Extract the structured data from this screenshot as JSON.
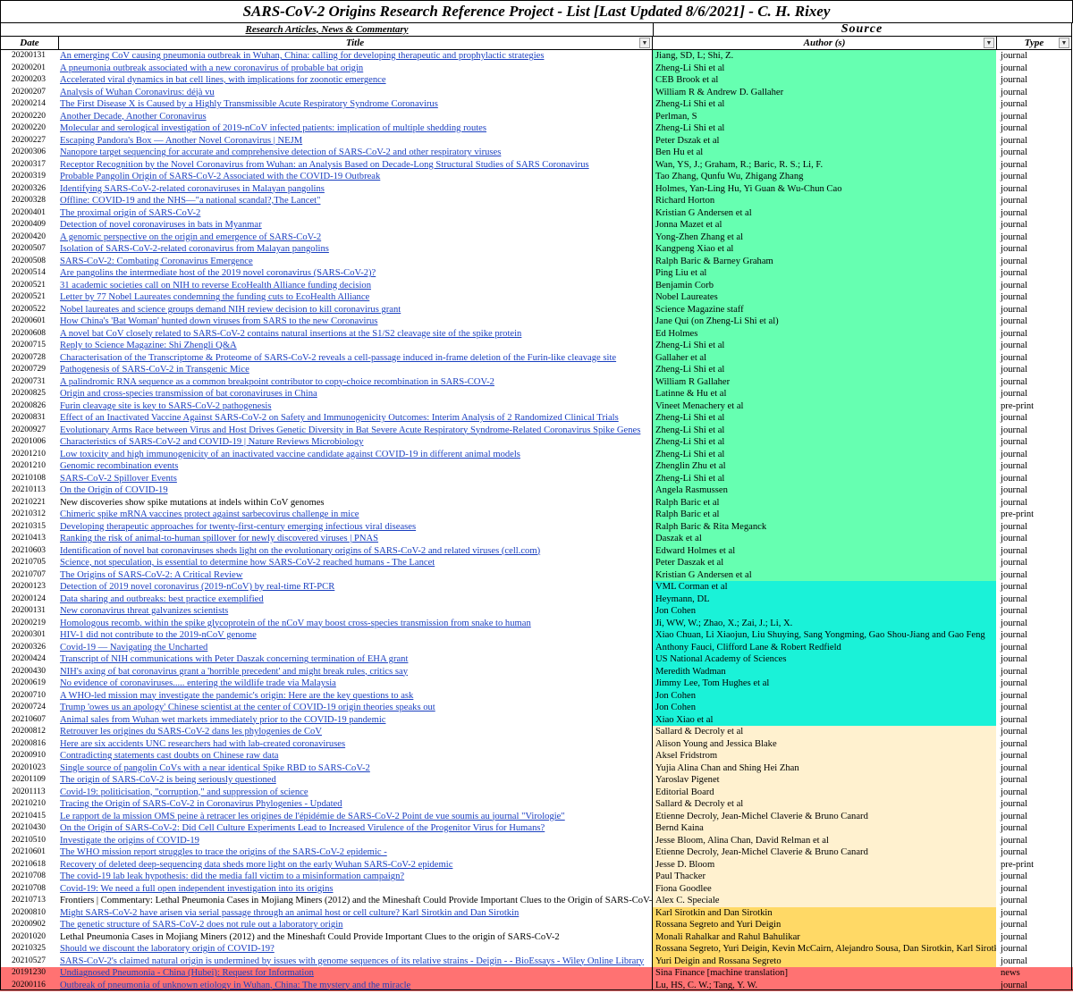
{
  "sheet": {
    "title": "SARS-CoV-2 Origins Research Reference Project - List [Last Updated 8/6/2021] - C. H. Rixey",
    "section_left": "Research Articles, News & Commentary",
    "section_right": "Source",
    "headers": {
      "date": "Date",
      "title": "Title",
      "author": "Author (s)",
      "type": "Type"
    },
    "filter_glyph": "▼",
    "band_colors": {
      "green": "#66ffb1",
      "teal": "#1af2d8",
      "peach": "#fff1cf",
      "yellow": "#ffd966",
      "red": "#ff7272"
    },
    "link_color": "#1a3fc0"
  },
  "rows": [
    {
      "date": "20200131",
      "title": "An emerging CoV causing pneumonia outbreak in Wuhan, China: calling for developing therapeutic and prophylactic strategies",
      "author": "Jiang, SD, L; Shi, Z.",
      "type": "journal",
      "band": "green",
      "link": true
    },
    {
      "date": "20200201",
      "title": "A pneumonia outbreak associated with a new coronavirus of probable bat origin",
      "author": "Zheng-Li Shi et al",
      "type": "journal",
      "band": "green",
      "link": true
    },
    {
      "date": "20200203",
      "title": "Accelerated viral dynamics in bat cell lines, with implications for zoonotic emergence",
      "author": "CEB Brook et al",
      "type": "journal",
      "band": "green",
      "link": true
    },
    {
      "date": "20200207",
      "title": "Analysis of Wuhan Coronavirus: déjà vu",
      "author": "William R & Andrew D. Gallaher",
      "type": "journal",
      "band": "green",
      "link": true
    },
    {
      "date": "20200214",
      "title": "The First Disease X is Caused by a Highly Transmissible Acute Respiratory Syndrome Coronavirus",
      "author": "Zheng-Li Shi et al",
      "type": "journal",
      "band": "green",
      "link": true
    },
    {
      "date": "20200220",
      "title": "Another Decade, Another Coronavirus",
      "author": "Perlman, S",
      "type": "journal",
      "band": "green",
      "link": true
    },
    {
      "date": "20200220",
      "title": "Molecular and serological investigation of 2019-nCoV infected patients: implication of multiple shedding routes",
      "author": "Zheng-Li Shi et al",
      "type": "journal",
      "band": "green",
      "link": true
    },
    {
      "date": "20200227",
      "title": "Escaping Pandora's Box — Another Novel Coronavirus | NEJM",
      "author": "Peter Dszak et al",
      "type": "journal",
      "band": "green",
      "link": true
    },
    {
      "date": "20200306",
      "title": "Nanopore target sequencing for accurate and comprehensive detection of SARS-CoV-2 and other respiratory viruses",
      "author": "Ben Hu et al",
      "type": "journal",
      "band": "green",
      "link": true
    },
    {
      "date": "20200317",
      "title": "Receptor Recognition by the Novel Coronavirus from Wuhan: an Analysis Based on Decade-Long Structural Studies of SARS Coronavirus",
      "author": "Wan, YS, J.; Graham, R.; Baric, R. S.; Li, F.",
      "type": "journal",
      "band": "green",
      "link": true
    },
    {
      "date": "20200319",
      "title": "Probable Pangolin Origin of SARS-CoV-2 Associated with the COVID-19 Outbreak",
      "author": "Tao Zhang, Qunfu Wu, Zhigang Zhang",
      "type": "journal",
      "band": "green",
      "link": true
    },
    {
      "date": "20200326",
      "title": "Identifying SARS-CoV-2-related coronaviruses in Malayan pangolins",
      "author": "Holmes, Yan-Ling Hu, Yi Guan & Wu-Chun Cao",
      "type": "journal",
      "band": "green",
      "link": true
    },
    {
      "date": "20200328",
      "title": "Offline: COVID-19 and the NHS—\"a national scandal?,The Lancet\"",
      "author": "Richard Horton",
      "type": "journal",
      "band": "green",
      "link": true
    },
    {
      "date": "20200401",
      "title": "The proximal origin of SARS-CoV-2",
      "author": "Kristian G Andersen et al",
      "type": "journal",
      "band": "green",
      "link": true
    },
    {
      "date": "20200409",
      "title": "Detection of novel coronaviruses in bats in Myanmar",
      "author": "Jonna Mazet et al",
      "type": "journal",
      "band": "green",
      "link": true
    },
    {
      "date": "20200420",
      "title": "A genomic perspective on the origin and emergence of SARS-CoV-2",
      "author": "Yong-Zhen Zhang et al",
      "type": "journal",
      "band": "green",
      "link": true
    },
    {
      "date": "20200507",
      "title": "Isolation of SARS-CoV-2-related coronavirus from Malayan pangolins",
      "author": "Kangpeng Xiao et al",
      "type": "journal",
      "band": "green",
      "link": true
    },
    {
      "date": "20200508",
      "title": "SARS-CoV-2: Combating Coronavirus Emergence",
      "author": "Ralph Baric & Barney Graham",
      "type": "journal",
      "band": "green",
      "link": true
    },
    {
      "date": "20200514",
      "title": "Are pangolins the intermediate host of the 2019 novel coronavirus (SARS-CoV-2)?",
      "author": "Ping Liu et al",
      "type": "journal",
      "band": "green",
      "link": true
    },
    {
      "date": "20200521",
      "title": "31 academic societies call on NIH to reverse EcoHealth Alliance funding decision",
      "author": "Benjamin Corb",
      "type": "journal",
      "band": "green",
      "link": true
    },
    {
      "date": "20200521",
      "title": "Letter by 77 Nobel Laureates condemning the funding cuts to EcoHealth Alliance",
      "author": "Nobel Laureates",
      "type": "journal",
      "band": "green",
      "link": true
    },
    {
      "date": "20200522",
      "title": "Nobel laureates and science groups demand NIH review decision to kill coronavirus grant",
      "author": "Science Magazine staff",
      "type": "journal",
      "band": "green",
      "link": true
    },
    {
      "date": "20200601",
      "title": "How China's 'Bat Woman' hunted down viruses from SARS to the new Coronavirus",
      "author": "Jane Qui (on Zheng-Li Shi et al)",
      "type": "journal",
      "band": "green",
      "link": true
    },
    {
      "date": "20200608",
      "title": "A novel bat CoV closely related to SARS-CoV-2 contains natural insertions at the S1/S2 cleavage site of the spike protein",
      "author": "Ed Holmes",
      "type": "journal",
      "band": "green",
      "link": true
    },
    {
      "date": "20200715",
      "title": "Reply to Science Magazine: Shi Zhengli Q&A",
      "author": "Zheng-Li Shi et al",
      "type": "journal",
      "band": "green",
      "link": true
    },
    {
      "date": "20200728",
      "title": "Characterisation of the Transcriptome & Proteome of SARS-CoV-2 reveals a cell-passage induced in-frame deletion of the Furin-like cleavage site",
      "author": "Gallaher et al",
      "type": "journal",
      "band": "green",
      "link": true
    },
    {
      "date": "20200729",
      "title": "Pathogenesis of SARS-CoV-2 in Transgenic Mice",
      "author": "Zheng-Li Shi et al",
      "type": "journal",
      "band": "green",
      "link": true
    },
    {
      "date": "20200731",
      "title": "A palindromic RNA sequence as a common breakpoint contributor to copy-choice recombination in SARS-COV-2",
      "author": "William R Gallaher",
      "type": "journal",
      "band": "green",
      "link": true
    },
    {
      "date": "20200825",
      "title": "Origin and cross-species transmission of bat coronaviruses in China",
      "author": "Latinne & Hu et al",
      "type": "journal",
      "band": "green",
      "link": true
    },
    {
      "date": "20200826",
      "title": "Furin cleavage site is key to SARS-CoV-2 pathogenesis",
      "author": "Vineet Menachery et al",
      "type": "pre-print",
      "band": "green",
      "link": true
    },
    {
      "date": "20200831",
      "title": "Effect of an Inactivated Vaccine Against SARS-CoV-2 on Safety and Immunogenicity Outcomes: Interim Analysis of 2 Randomized Clinical Trials",
      "author": "Zheng-Li Shi et al",
      "type": "journal",
      "band": "green",
      "link": true
    },
    {
      "date": "20200927",
      "title": "Evolutionary Arms Race between Virus and Host Drives Genetic Diversity in Bat Severe Acute Respiratory Syndrome-Related Coronavirus Spike Genes",
      "author": "Zheng-Li Shi et al",
      "type": "journal",
      "band": "green",
      "link": true
    },
    {
      "date": "20201006",
      "title": "Characteristics of SARS-CoV-2 and COVID-19 | Nature Reviews Microbiology",
      "author": "Zheng-Li Shi et al",
      "type": "journal",
      "band": "green",
      "link": true
    },
    {
      "date": "20201210",
      "title": "Low toxicity and high immunogenicity of an inactivated vaccine candidate against COVID-19 in different animal models",
      "author": "Zheng-Li Shi et al",
      "type": "journal",
      "band": "green",
      "link": true
    },
    {
      "date": "20201210",
      "title": "Genomic recombination events",
      "author": "Zhenglin Zhu et al",
      "type": "journal",
      "band": "green",
      "link": true
    },
    {
      "date": "20210108",
      "title": "SARS-CoV-2 Spillover Events",
      "author": "Zheng-Li Shi et al",
      "type": "journal",
      "band": "green",
      "link": true
    },
    {
      "date": "20210113",
      "title": "On the Origin of COVID-19",
      "author": "Angela Rasmussen",
      "type": "journal",
      "band": "green",
      "link": true
    },
    {
      "date": "20210221",
      "title": "New discoveries show spike mutations at indels within CoV genomes",
      "author": "Ralph Baric et al",
      "type": "journal",
      "band": "green",
      "link": false
    },
    {
      "date": "20210312",
      "title": "Chimeric spike mRNA vaccines protect against sarbecovirus challenge in mice",
      "author": "Ralph Baric et al",
      "type": "pre-print",
      "band": "green",
      "link": true
    },
    {
      "date": "20210315",
      "title": "Developing therapeutic approaches for twenty-first-century emerging infectious viral diseases",
      "author": "Ralph Baric & Rita Meganck",
      "type": "journal",
      "band": "green",
      "link": true
    },
    {
      "date": "20210413",
      "title": "Ranking the risk of animal-to-human spillover for newly discovered viruses | PNAS",
      "author": "Daszak et al",
      "type": "journal",
      "band": "green",
      "link": true
    },
    {
      "date": "20210603",
      "title": "Identification of novel bat coronaviruses sheds light on the evolutionary origins of SARS-CoV-2 and related viruses (cell.com)",
      "author": "Edward Holmes et al",
      "type": "journal",
      "band": "green",
      "link": true
    },
    {
      "date": "20210705",
      "title": "Science, not speculation, is essential to determine how SARS-CoV-2 reached humans - The Lancet",
      "author": "Peter Daszak et al",
      "type": "journal",
      "band": "green",
      "link": true
    },
    {
      "date": "20210707",
      "title": "The Origins of SARS-CoV-2: A Critical Review",
      "author": "Kristian G Andersen et al",
      "type": "journal",
      "band": "green",
      "link": true
    },
    {
      "date": "20200123",
      "title": "Detection of 2019 novel coronavirus (2019-nCoV) by real-time RT-PCR",
      "author": "VML Corman et al",
      "type": "journal",
      "band": "teal",
      "link": true
    },
    {
      "date": "20200124",
      "title": "Data sharing and outbreaks: best practice exemplified",
      "author": "Heymann, DL",
      "type": "journal",
      "band": "teal",
      "link": true
    },
    {
      "date": "20200131",
      "title": "New coronavirus threat galvanizes scientists",
      "author": "Jon Cohen",
      "type": "journal",
      "band": "teal",
      "link": true
    },
    {
      "date": "20200219",
      "title": "Homologous recomb. within the spike glycoprotein of the nCoV may boost cross-species transmission from snake to human",
      "author": "Ji, WW, W.; Zhao, X.; Zai, J.; Li, X.",
      "type": "journal",
      "band": "teal",
      "link": true
    },
    {
      "date": "20200301",
      "title": "HIV-1 did not contribute to the 2019-nCoV genome",
      "author": "Xiao Chuan, Li Xiaojun, Liu Shuying, Sang Yongming, Gao Shou-Jiang and Gao Feng",
      "type": "journal",
      "band": "teal",
      "link": true
    },
    {
      "date": "20200326",
      "title": "Covid-19 — Navigating the Uncharted",
      "author": "Anthony Fauci, Clifford Lane & Robert Redfield",
      "type": "journal",
      "band": "teal",
      "link": true
    },
    {
      "date": "20200424",
      "title": "Transcript of NIH communications with Peter Daszak concerning termination of EHA grant",
      "author": "US National Academy of Sciences",
      "type": "journal",
      "band": "teal",
      "link": true
    },
    {
      "date": "20200430",
      "title": "NIH's axing of bat coronavirus grant a 'horrible precedent' and might break rules, critics say",
      "author": "Meredith Wadman",
      "type": "journal",
      "band": "teal",
      "link": true
    },
    {
      "date": "20200619",
      "title": "No evidence of coronaviruses..... entering the wildlife trade via Malaysia",
      "author": "Jimmy Lee, Tom Hughes et al",
      "type": "journal",
      "band": "teal",
      "link": true
    },
    {
      "date": "20200710",
      "title": "A WHO-led mission may investigate the pandemic's origin:  Here are the key questions to ask",
      "author": "Jon Cohen",
      "type": "journal",
      "band": "teal",
      "link": true
    },
    {
      "date": "20200724",
      "title": "Trump 'owes us an apology' Chinese scientist at the center of COVID-19 origin theories speaks out",
      "author": "Jon Cohen",
      "type": "journal",
      "band": "teal",
      "link": true
    },
    {
      "date": "20210607",
      "title": "Animal sales from Wuhan wet markets immediately prior to the COVID-19 pandemic",
      "author": "Xiao Xiao et al",
      "type": "journal",
      "band": "teal",
      "link": true
    },
    {
      "date": "20200812",
      "title": "Retrouver les origines du SARS-CoV-2 dans les phylogenies de CoV",
      "author": "Sallard & Decroly et al",
      "type": "journal",
      "band": "peach",
      "link": true
    },
    {
      "date": "20200816",
      "title": "Here are six accidents UNC researchers had with lab-created coronaviruses",
      "author": "Alison Young and Jessica Blake",
      "type": "journal",
      "band": "peach",
      "link": true
    },
    {
      "date": "20200910",
      "title": "Contradicting statements cast doubts on Chinese raw data",
      "author": "Aksel Fridstrom",
      "type": "journal",
      "band": "peach",
      "link": true
    },
    {
      "date": "20201023",
      "title": "Single source of pangolin CoVs with a near identical Spike RBD to SARS-CoV-2",
      "author": "Yujia Alina Chan and Shing Hei Zhan",
      "type": "journal",
      "band": "peach",
      "link": true
    },
    {
      "date": "20201109",
      "title": "The origin of SARS-CoV-2 is being seriously questioned",
      "author": "Yaroslav Pigenet",
      "type": "journal",
      "band": "peach",
      "link": true
    },
    {
      "date": "20201113",
      "title": "Covid-19: politicisation, \"corruption,\" and suppression of science",
      "author": "Editorial Board",
      "type": "journal",
      "band": "peach",
      "link": true
    },
    {
      "date": "20210210",
      "title": "Tracing the Origin of SARS-CoV-2 in Coronavirus Phylogenies - Updated",
      "author": "Sallard & Decroly et al",
      "type": "journal",
      "band": "peach",
      "link": true
    },
    {
      "date": "20210415",
      "title": "Le rapport de la mission OMS peine à retracer les origines de l'épidémie de SARS-CoV-2 Point de vue soumis au journal \"Virologie\"",
      "author": "Etienne Decroly, Jean-Michel Claverie & Bruno Canard",
      "type": "journal",
      "band": "peach",
      "link": true
    },
    {
      "date": "20210430",
      "title": "On the Origin of SARS-CoV-2: Did Cell Culture Experiments Lead to Increased Virulence of the Progenitor Virus for Humans?",
      "author": "Bernd Kaina",
      "type": "journal",
      "band": "peach",
      "link": true
    },
    {
      "date": "20210510",
      "title": "Investigate the origins of COVID-19",
      "author": "Jesse Bloom, Alina Chan, David Relman et al",
      "type": "journal",
      "band": "peach",
      "link": true
    },
    {
      "date": "20210601",
      "title": "The WHO mission report struggles to trace the origins of the SARS-CoV-2 epidemic -",
      "author": "Etienne Decroly, Jean-Michel Claverie & Bruno Canard",
      "type": "journal",
      "band": "peach",
      "link": true
    },
    {
      "date": "20210618",
      "title": "Recovery of deleted deep-sequencing data sheds more light on the early Wuhan SARS-CoV-2 epidemic",
      "author": "Jesse D. Bloom",
      "type": "pre-print",
      "band": "peach",
      "link": true
    },
    {
      "date": "20210708",
      "title": "The covid-19 lab leak hypothesis: did the media fall victim to a misinformation campaign?",
      "author": "Paul Thacker",
      "type": "journal",
      "band": "peach",
      "link": true
    },
    {
      "date": "20210708",
      "title": "Covid-19: We need a full open independent investigation into its origins",
      "author": "Fiona Goodlee",
      "type": "journal",
      "band": "peach",
      "link": true
    },
    {
      "date": "20210713",
      "title": "Frontiers | Commentary: Lethal Pneumonia Cases in Mojiang Miners (2012) and the Mineshaft Could Provide Important Clues to the Origin of SARS-CoV-2",
      "author": "Alex C. Speciale",
      "type": "journal",
      "band": "peach",
      "link": false
    },
    {
      "date": "20200810",
      "title": "Might SARS-CoV-2 have arisen via serial passage through an animal host or cell culture? Karl Sirotkin and Dan Sirotkin",
      "author": "Karl Sirotkin and Dan Sirotkin",
      "type": "journal",
      "band": "yellow",
      "link": true
    },
    {
      "date": "20200902",
      "title": "The genetic structure of SARS-CoV-2 does not rule out a laboratory origin",
      "author": "Rossana Segreto and Yuri Deigin",
      "type": "journal",
      "band": "yellow",
      "link": true
    },
    {
      "date": "20201020",
      "title": "Lethal Pneumonia Cases in Mojiang Miners (2012) and the Mineshaft Could Provide Important Clues to the origin of SARS-CoV-2",
      "author": "Monali Rahalkar and Rahul Bahulikar",
      "type": "journal",
      "band": "yellow",
      "link": false
    },
    {
      "date": "20210325",
      "title": "Should we discount the laboratory origin of COVID-19?",
      "author": "Rossana Segreto, Yuri Deigin, Kevin McCairn, Alejandro Sousa, Dan Sirotkin, Karl Sirotkin",
      "type": "journal",
      "band": "yellow",
      "link": true
    },
    {
      "date": "20210527",
      "title": "SARS-CoV-2's claimed natural origin is undermined by issues with genome sequences of its relative strains - Deigin - - BioEssays - Wiley Online Library",
      "author": "Yuri Deigin and Rossana Segreto",
      "type": "journal",
      "band": "yellow",
      "link": true
    },
    {
      "date": "20191230",
      "title": "Undiagnosed Pneumonia - China (Hubei): Request for Information",
      "author": "Sina Finance [machine translation]",
      "type": "news",
      "band": "red",
      "link": true
    },
    {
      "date": "20200116",
      "title": "Outbreak of pneumonia of unknown etiology in Wuhan, China: The mystery and the miracle",
      "author": "Lu, HS, C. W.; Tang, Y. W.",
      "type": "journal",
      "band": "red",
      "link": true
    }
  ]
}
